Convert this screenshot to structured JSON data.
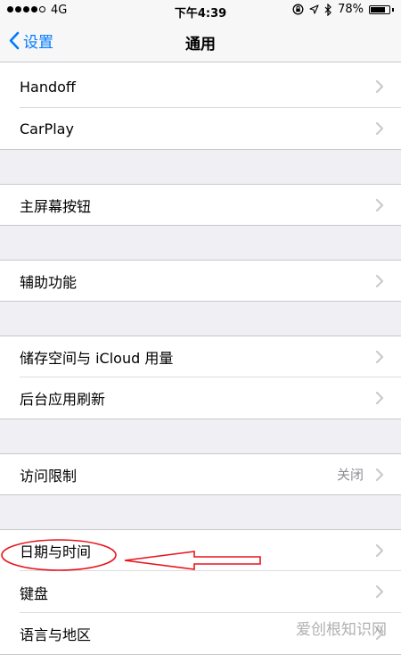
{
  "status_bar": {
    "carrier": "4G",
    "time": "下午4:39",
    "battery": "78%",
    "battery_level": 0.78
  },
  "nav": {
    "back_label": "设置",
    "title": "通用"
  },
  "groups": [
    {
      "items": [
        {
          "label": "Handoff"
        },
        {
          "label": "CarPlay"
        }
      ]
    },
    {
      "items": [
        {
          "label": "主屏幕按钮"
        }
      ]
    },
    {
      "items": [
        {
          "label": "辅助功能"
        }
      ]
    },
    {
      "items": [
        {
          "label": "储存空间与 iCloud 用量"
        },
        {
          "label": "后台应用刷新"
        }
      ]
    },
    {
      "items": [
        {
          "label": "访问限制",
          "value": "关闭"
        }
      ]
    },
    {
      "items": [
        {
          "label": "日期与时间"
        },
        {
          "label": "键盘"
        },
        {
          "label": "语言与地区"
        }
      ]
    }
  ],
  "annotation": {
    "color": "#e8141c"
  },
  "watermark": "爱创根知识网",
  "colors": {
    "accent": "#007aff",
    "background": "#efeff4",
    "chevron": "#c7c7cc"
  }
}
